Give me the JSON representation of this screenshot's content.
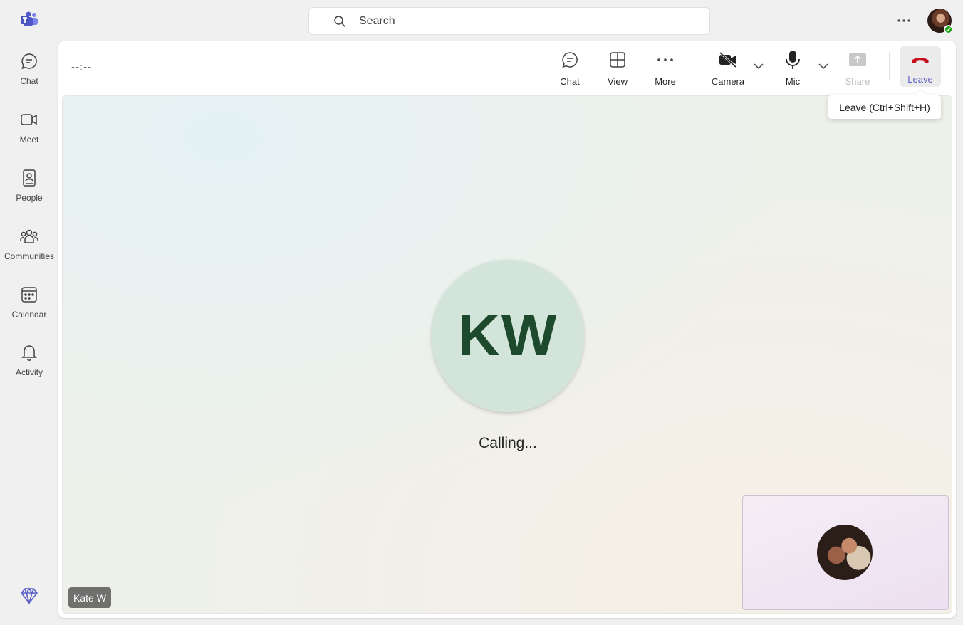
{
  "app": {
    "name": "Microsoft Teams"
  },
  "rail": {
    "items": [
      {
        "label": "Chat"
      },
      {
        "label": "Meet"
      },
      {
        "label": "People"
      },
      {
        "label": "Communities"
      },
      {
        "label": "Calendar"
      },
      {
        "label": "Activity"
      }
    ]
  },
  "search": {
    "placeholder": "Search"
  },
  "meeting": {
    "timer": "--:--",
    "toolbar": {
      "chat_label": "Chat",
      "view_label": "View",
      "more_label": "More",
      "camera_label": "Camera",
      "mic_label": "Mic",
      "share_label": "Share",
      "leave_label": "Leave"
    },
    "tooltip": "Leave (Ctrl+Shift+H)",
    "callee_initials": "KW",
    "status": "Calling...",
    "callee_name": "Kate W"
  },
  "colors": {
    "accent": "#5b5fc7",
    "leave_red": "#c50f1f",
    "presence_available": "#13a10e",
    "avatar_bg": "#d3e4da",
    "avatar_text": "#1d4a2c"
  }
}
